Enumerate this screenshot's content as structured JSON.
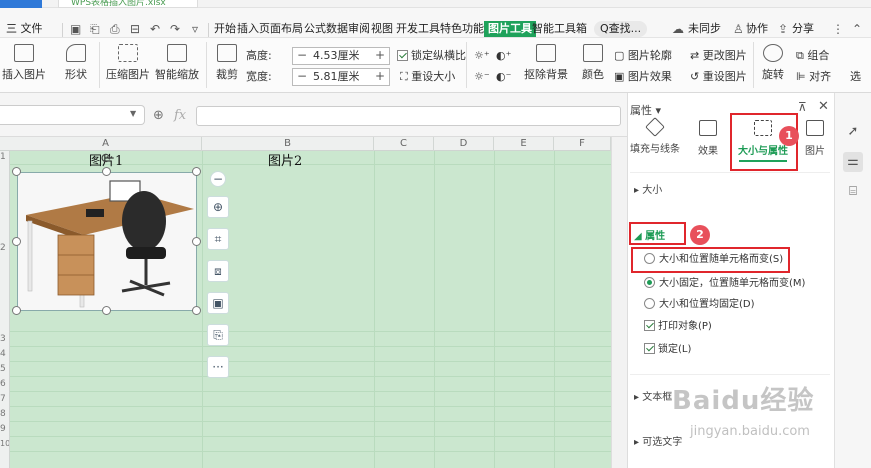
{
  "title_strip": {
    "doc_tab": "WPS表格插入图片.xlsx"
  },
  "menu": {
    "file": "三 文件",
    "tabs": [
      "开始",
      "插入",
      "页面布局",
      "公式",
      "数据",
      "审阅",
      "视图",
      "开发工具",
      "特色功能",
      "图片工具",
      "智能工具箱"
    ],
    "active_tab": "图片工具",
    "search": "Q查找...",
    "sync": "未同步",
    "collab": "协作",
    "share": "分享"
  },
  "ribbon": {
    "insert_picture": "插入图片",
    "shape": "形状",
    "compress": "压缩图片",
    "smart_scale": "智能缩放",
    "crop": "裁剪",
    "height_label": "高度:",
    "height_value": "4.53厘米",
    "width_label": "宽度:",
    "width_value": "5.81厘米",
    "lock_ratio": "锁定纵横比",
    "reset_size": "重设大小",
    "remove_bg": "抠除背景",
    "color": "颜色",
    "outline": "图片轮廓",
    "effect": "图片效果",
    "change_pic": "更改图片",
    "reset_pic": "重设图片",
    "rotate": "旋转",
    "group": "组合",
    "align": "对齐",
    "select": "选"
  },
  "grid": {
    "col_headers": [
      "A",
      "B",
      "C",
      "D",
      "E",
      "F"
    ],
    "row_numbers": [
      "1",
      "2",
      "3",
      "4",
      "5",
      "6",
      "7",
      "8",
      "9",
      "10"
    ],
    "cell_a1": "图片1",
    "cell_b1": "图片2"
  },
  "panel": {
    "title": "属性",
    "tabs": [
      "填充与线条",
      "效果",
      "大小与属性",
      "图片"
    ],
    "active_tab": "大小与属性",
    "section_size": "大小",
    "section_props": "属性",
    "options": [
      "大小和位置随单元格而变(S)",
      "大小固定，位置随单元格而变(M)",
      "大小和位置均固定(D)"
    ],
    "selected_option": 1,
    "print_obj": "打印对象(P)",
    "locked": "锁定(L)",
    "section_textbox": "文本框",
    "section_alt": "可选文字",
    "badge1": "1",
    "badge2": "2"
  },
  "watermark": {
    "brand": "Baidu经验",
    "url": "jingyan.baidu.com"
  },
  "colors": {
    "accent": "#1fa25b",
    "highlight": "#e0262c",
    "sheet": "#cbe7cf"
  }
}
